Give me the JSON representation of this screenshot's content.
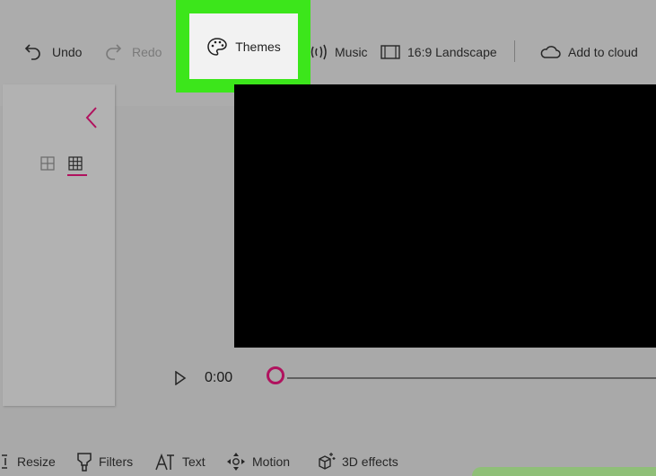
{
  "toolbar": {
    "undo": "Undo",
    "redo": "Redo",
    "themes": "Themes",
    "music": "Music",
    "aspect": "16:9 Landscape",
    "cloud": "Add to cloud"
  },
  "player": {
    "time": "0:00",
    "progress": 0
  },
  "bottom": {
    "resize": "Resize",
    "filters": "Filters",
    "text": "Text",
    "motion": "Motion",
    "effects3d": "3D effects"
  },
  "icons": {
    "undo": "undo-icon",
    "redo": "redo-icon",
    "themes": "palette-icon",
    "music": "music-icon",
    "aspect": "aspect-ratio-icon",
    "cloud": "cloud-icon",
    "collapse": "chevron-left-icon",
    "view_small": "grid-small-icon",
    "view_large": "grid-large-icon",
    "play": "play-icon",
    "resize": "resize-icon",
    "filters": "filters-icon",
    "text": "text-icon",
    "motion": "motion-icon",
    "effects3d": "3d-effects-icon"
  },
  "colors": {
    "accent": "#b0125e",
    "highlight": "#3ce61b"
  }
}
